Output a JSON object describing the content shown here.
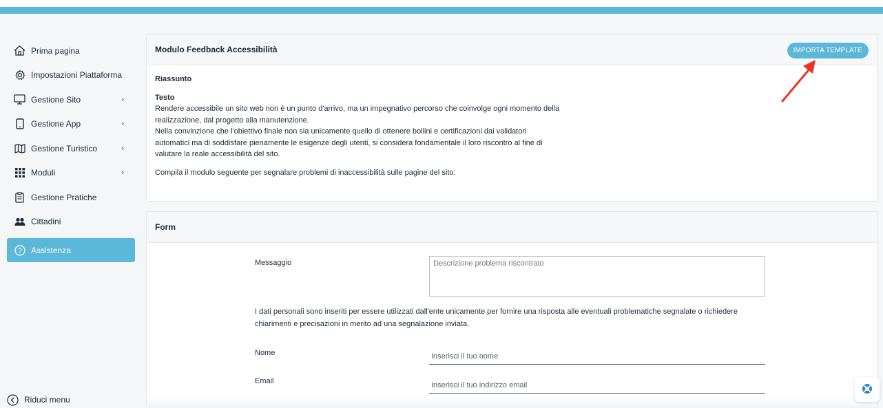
{
  "sidebar": {
    "items": [
      {
        "label": "Prima pagina",
        "icon": "home-icon"
      },
      {
        "label": "Impostazioni Piattaforma",
        "icon": "gear-icon"
      },
      {
        "label": "Gestione Sito",
        "icon": "monitor-icon"
      },
      {
        "label": "Gestione App",
        "icon": "phone-icon"
      },
      {
        "label": "Gestione Turistico",
        "icon": "map-icon"
      },
      {
        "label": "Moduli",
        "icon": "grid-icon"
      },
      {
        "label": "Gestione Pratiche",
        "icon": "clipboard-icon"
      },
      {
        "label": "Cittadini",
        "icon": "users-icon"
      },
      {
        "label": "Assistenza",
        "icon": "help-circle-icon"
      }
    ],
    "collapse_label": "Riduci menu"
  },
  "summary_card": {
    "title": "Modulo Feedback Accessibilità",
    "import_button": "IMPORTA TEMPLATE",
    "section_heading": "Riassunto",
    "text_heading": "Testo",
    "paragraph1": "Rendere accessibile un sito web non è un punto d'arrivo, ma un impegnativo percorso che coinvolge ogni momento della realizzazione, dal progetto alla manutenzione.",
    "paragraph2": "Nella convinzione che l'obiettivo finale non sia unicamente quello di ottenere bollini e certificazioni dai validatori automatici ma di soddisfare pienamente le esigenze degli utenti, si considera fondamentale il loro riscontro al fine di valutare la reale accessibilità del sito.",
    "paragraph3": "Compila il modulo seguente per segnalare problemi di inaccessibilità sulle pagine del sito:"
  },
  "form_card": {
    "title": "Form",
    "message_label": "Messaggio",
    "message_placeholder": "Descrizione problema riscontrato",
    "privacy_note": "I dati personali sono inseriti per essere utilizzati dall'ente unicamente per fornire una risposta alle eventuali problematiche segnalate o richiedere chiarimenti e precisazioni in merito ad una segnalazione inviata.",
    "name_label": "Nome",
    "name_placeholder": "Inserisci il tuo nome",
    "email_label": "Email",
    "email_placeholder": "Inserisci il tuo indirizzo email"
  },
  "colors": {
    "accent": "#5bb8d8",
    "annotation_arrow": "#e8332a"
  }
}
